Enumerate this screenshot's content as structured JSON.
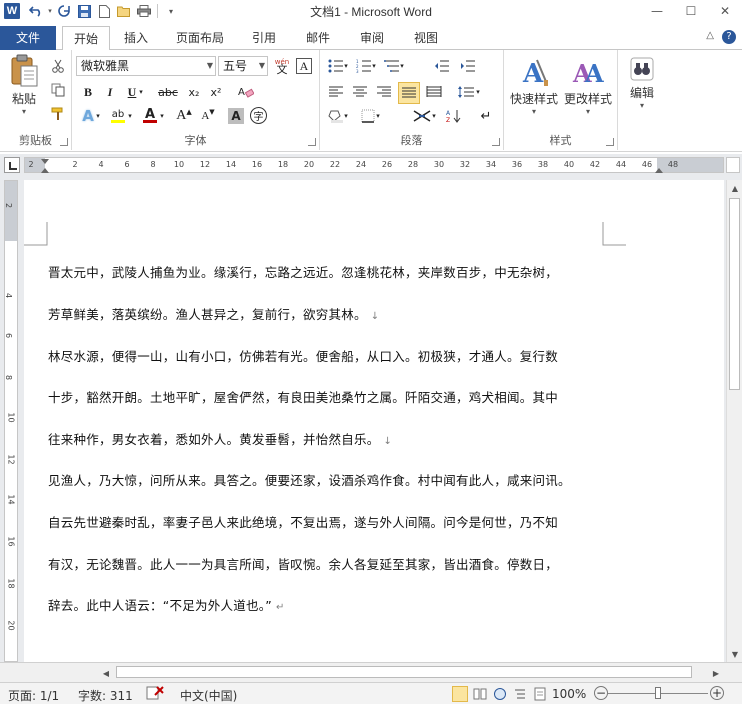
{
  "app": {
    "logo_letter": "W",
    "title": "文档1  -  Microsoft Word"
  },
  "window_controls": {
    "minimize": "—",
    "maximize": "☐",
    "close": "✕"
  },
  "tabs": {
    "file": "文件",
    "items": [
      "开始",
      "插入",
      "页面布局",
      "引用",
      "邮件",
      "审阅",
      "视图"
    ],
    "active": "开始",
    "minimize_ribbon": "△",
    "help": "?"
  },
  "ribbon": {
    "clipboard": {
      "paste": "粘贴",
      "label": "剪贴板"
    },
    "font": {
      "family": "微软雅黑",
      "size": "五号",
      "wen": "wén",
      "wen_char": "文",
      "a_box": "A",
      "bold": "B",
      "italic": "I",
      "underline": "U",
      "strike": "abc",
      "subscript": "x₂",
      "superscript": "x²",
      "highlight": "ab",
      "font_color": "A",
      "size_up": "A",
      "size_down": "A",
      "shade": "A",
      "enclose": "字",
      "aa": "Aa",
      "label": "字体"
    },
    "paragraph": {
      "label": "段落"
    },
    "styles": {
      "quick": "快速样式",
      "change": "更改样式",
      "label": "样式"
    },
    "editing": {
      "edit": "编辑"
    }
  },
  "ruler": {
    "ticks": [
      "2",
      "2",
      "4",
      "6",
      "8",
      "10",
      "12",
      "14",
      "16",
      "18",
      "20",
      "22",
      "24",
      "26",
      "28",
      "30",
      "32",
      "34",
      "36",
      "38",
      "40",
      "42",
      "44",
      "46",
      "48"
    ],
    "vticks": [
      "2",
      "4",
      "6",
      "8",
      "10",
      "12",
      "14",
      "16",
      "18",
      "20"
    ]
  },
  "document": {
    "lines": [
      {
        "text": "晋太元中，武陵人捕鱼为业。缘溪行，忘路之远近。忽逢桃花林，夹岸数百步，中无杂树，",
        "mark": ""
      },
      {
        "text": "芳草鲜美，落英缤纷。渔人甚异之，复前行，欲穷其林。",
        "mark": "↓"
      },
      {
        "text": "林尽水源，便得一山，山有小口，仿佛若有光。便舍船，从口入。初极狭，才通人。复行数",
        "mark": ""
      },
      {
        "text": "十步，豁然开朗。土地平旷，屋舍俨然，有良田美池桑竹之属。阡陌交通，鸡犬相闻。其中",
        "mark": ""
      },
      {
        "text": "往来种作，男女衣着，悉如外人。黄发垂髫，并怡然自乐。",
        "mark": "↓"
      },
      {
        "text": "见渔人，乃大惊，问所从来。具答之。便要还家，设酒杀鸡作食。村中闻有此人，咸来问讯。",
        "mark": ""
      },
      {
        "text": "自云先世避秦时乱，率妻子邑人来此绝境，不复出焉，遂与外人间隔。问今是何世，乃不知",
        "mark": ""
      },
      {
        "text": "有汉，无论魏晋。此人一一为具言所闻，皆叹惋。余人各复延至其家，皆出酒食。停数日，",
        "mark": ""
      },
      {
        "text": "辞去。此中人语云：“不足为外人道也。”",
        "mark": "↵"
      }
    ]
  },
  "statusbar": {
    "page": "页面: 1/1",
    "words": "字数: 311",
    "language": "中文(中国)",
    "zoom": "100%",
    "zoom_minus": "−",
    "zoom_plus": "+",
    "zoom_level": 0.5
  },
  "colors": {
    "accent": "#2b579a",
    "selected": "#fbe5a0"
  }
}
